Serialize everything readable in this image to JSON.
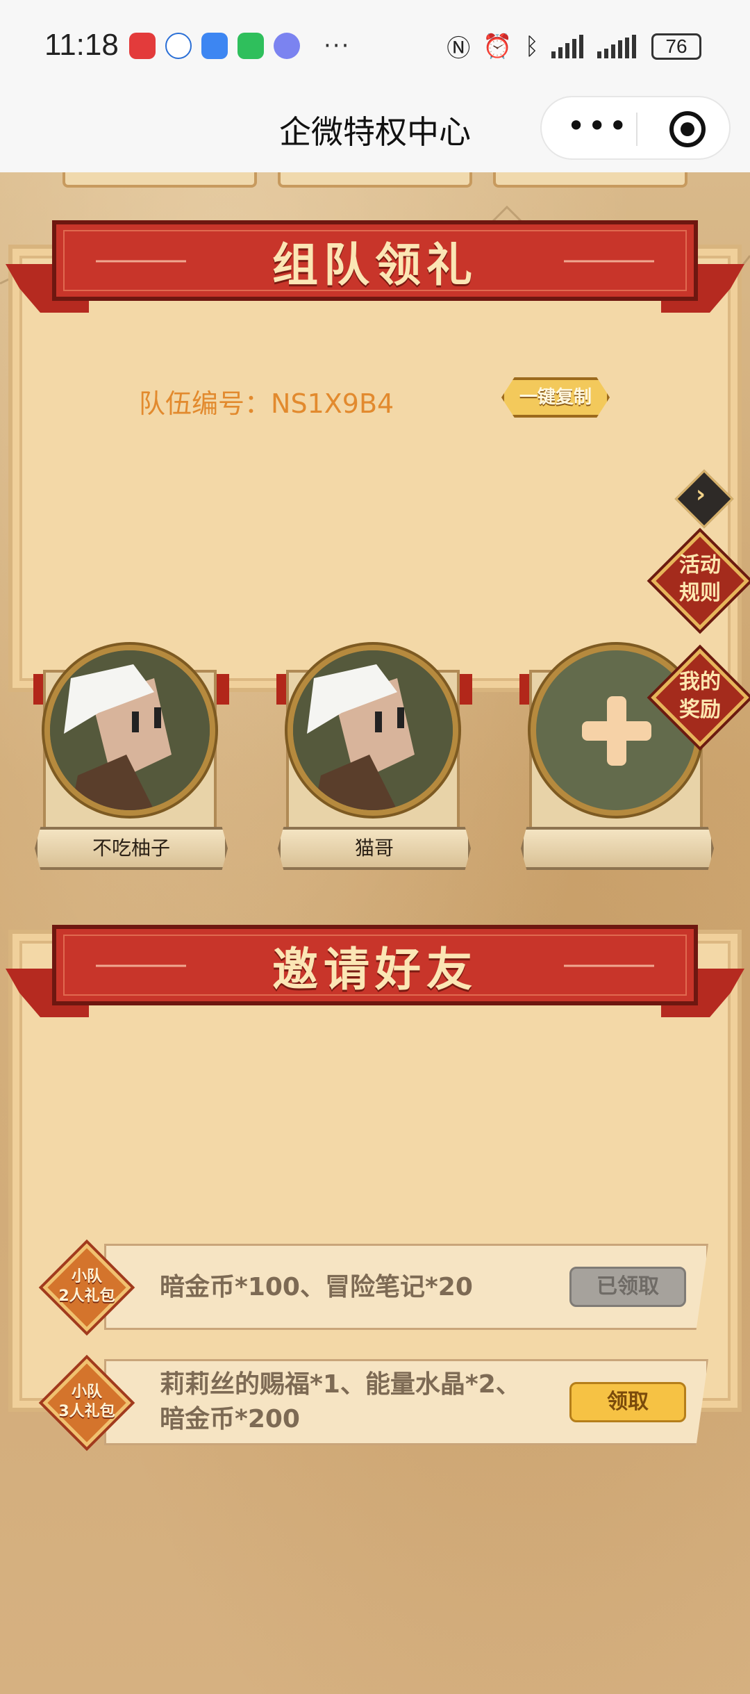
{
  "status_bar": {
    "time": "11:18",
    "battery": "76",
    "more": "···"
  },
  "nav": {
    "title": "企微特权中心",
    "more": "•••"
  },
  "team_section": {
    "title": "组队领礼",
    "team_id_label": "队伍编号：",
    "team_id": "NS1X9B4",
    "copy_label": "一键复制",
    "rules_label_1": "活动",
    "rules_label_2": "规则",
    "rewards_label_1": "我的",
    "rewards_label_2": "奖励",
    "members": [
      {
        "name": "不吃柚子"
      },
      {
        "name": "猫哥"
      },
      {
        "name": ""
      }
    ]
  },
  "invite_section": {
    "title": "邀请好友",
    "rewards": [
      {
        "badge_line1": "小队",
        "badge_line2": "2人礼包",
        "text_line1": "暗金币*100、冒险笔记*20",
        "text_line2": "",
        "button": "已领取",
        "state": "claimed"
      },
      {
        "badge_line1": "小队",
        "badge_line2": "3人礼包",
        "text_line1": "莉莉丝的赐福*1、能量水晶*2、",
        "text_line2": "暗金币*200",
        "button": "领取",
        "state": "available"
      }
    ]
  },
  "colors": {
    "ribbon_red": "#c8352a",
    "team_id": "#e28a2e",
    "claim_button": "#f6c244",
    "claimed_button": "#a6a29c"
  }
}
